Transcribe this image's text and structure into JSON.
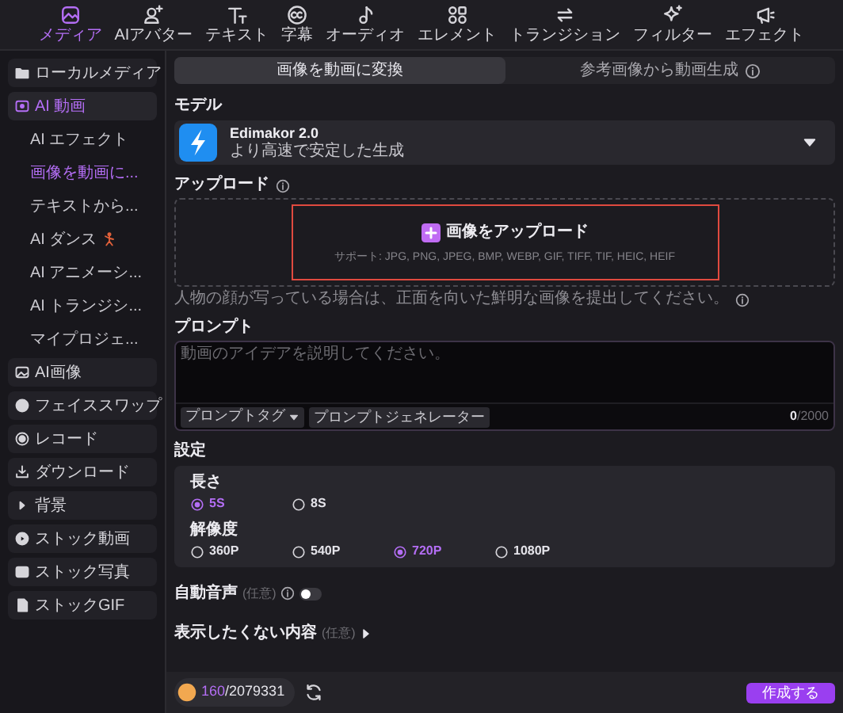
{
  "toolbar": [
    {
      "label": "メディア",
      "selected": true
    },
    {
      "label": "AIアバター",
      "selected": false
    },
    {
      "label": "テキスト",
      "selected": false
    },
    {
      "label": "字幕",
      "selected": false
    },
    {
      "label": "オーディオ",
      "selected": false
    },
    {
      "label": "エレメント",
      "selected": false
    },
    {
      "label": "トランジション",
      "selected": false
    },
    {
      "label": "フィルター",
      "selected": false
    },
    {
      "label": "エフェクト",
      "selected": false
    }
  ],
  "sidebar": {
    "items": [
      {
        "label": "ローカルメディア",
        "selected": false
      },
      {
        "label": "AI 動画",
        "selected": true,
        "children": [
          {
            "label": "AI エフェクト",
            "selected": false
          },
          {
            "label": "画像を動画に...",
            "selected": true
          },
          {
            "label": "テキストから...",
            "selected": false
          },
          {
            "label": "AI ダンス",
            "selected": false
          },
          {
            "label": "AI アニメーシ...",
            "selected": false
          },
          {
            "label": "AI トランジシ...",
            "selected": false
          },
          {
            "label": "マイプロジェ...",
            "selected": false
          }
        ]
      },
      {
        "label": "AI画像",
        "selected": false
      },
      {
        "label": "フェイススワップ",
        "selected": false
      },
      {
        "label": "レコード",
        "selected": false
      },
      {
        "label": "ダウンロード",
        "selected": false
      },
      {
        "label": "背景",
        "selected": false
      },
      {
        "label": "ストック動画",
        "selected": false
      },
      {
        "label": "ストック写真",
        "selected": false
      },
      {
        "label": "ストックGIF",
        "selected": false
      }
    ]
  },
  "tabs": [
    {
      "label": "画像を動画に変換",
      "selected": true
    },
    {
      "label": "参考画像から動画生成",
      "selected": false
    }
  ],
  "model": {
    "label": "モデル",
    "name": "Edimakor 2.0",
    "description": "より高速で安定した生成"
  },
  "upload": {
    "label": "アップロード",
    "button": "画像をアップロード",
    "formats": "サポート: JPG, PNG, JPEG, BMP, WEBP, GIF, TIFF, TIF, HEIC, HEIF",
    "note": "人物の顔が写っている場合は、正面を向いた鮮明な画像を提出してください。"
  },
  "prompt": {
    "label": "プロンプト",
    "placeholder": "動画のアイデアを説明してください。",
    "tag_button": "プロンプトタグ",
    "generator_button": "プロンプトジェネレーター",
    "count": "0",
    "max": "/2000"
  },
  "settings": {
    "label": "設定",
    "groups": [
      {
        "label": "長さ",
        "options": [
          {
            "label": "5S",
            "selected": true
          },
          {
            "label": "8S",
            "selected": false
          }
        ]
      },
      {
        "label": "解像度",
        "options": [
          {
            "label": "360P",
            "selected": false
          },
          {
            "label": "540P",
            "selected": false
          },
          {
            "label": "720P",
            "selected": true
          },
          {
            "label": "1080P",
            "selected": false
          }
        ]
      }
    ]
  },
  "auto_audio": {
    "label": "自動音声",
    "optional": "(任意)",
    "on": false
  },
  "negative": {
    "label": "表示したくない内容",
    "optional": "(任意)"
  },
  "footer": {
    "credits_used": "160",
    "credits_total": "/2079331",
    "create_button": "作成する"
  }
}
